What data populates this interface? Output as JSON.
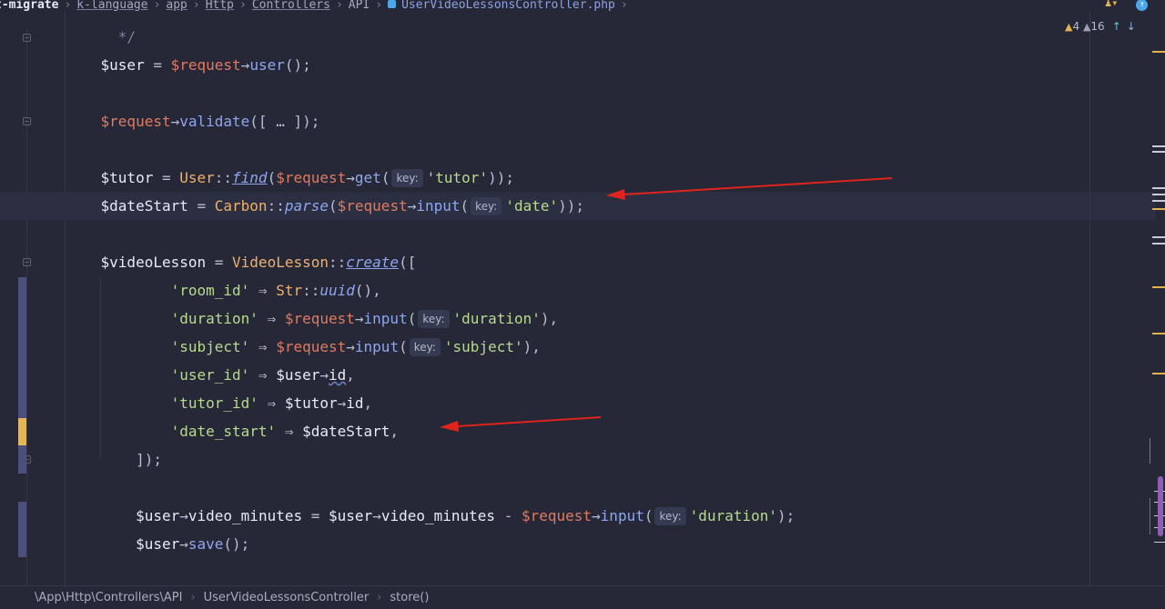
{
  "breadcrumb": {
    "items": [
      "t-migrate",
      "k-language",
      "app",
      "Http",
      "Controllers",
      "API",
      "UserVideoLessonsController.php"
    ]
  },
  "inspections": {
    "warnings": "4",
    "weak_warnings": "16",
    "icons": [
      "warning-icon",
      "weak-warning-icon",
      "prev-highlight-icon",
      "next-highlight-icon"
    ]
  },
  "top_right": {
    "icons": [
      "users-icon",
      "update-icon"
    ]
  },
  "code": {
    "comment_end": "*/",
    "l_user": {
      "var": "$user",
      "eq": " = ",
      "req": "$request",
      "arrow": "→",
      "fn": "user",
      "tail": "();"
    },
    "l_validate": {
      "req": "$request",
      "arrow": "→",
      "fn": "validate",
      "tail": "([ … ]);"
    },
    "l_tutor": {
      "var": "$tutor",
      "eq": " = ",
      "cls": "User",
      "dc": "::",
      "sfn": "find",
      "open": "(",
      "req": "$request",
      "arrow": "→",
      "fn": "get",
      "paren": "(",
      "hint": "key:",
      "str": "'tutor'",
      "tail": "));"
    },
    "l_date": {
      "var": "$dateStart",
      "eq": " = ",
      "cls": "Carbon",
      "dc": "::",
      "sfn": "parse",
      "open": "(",
      "req": "$request",
      "arrow": "→",
      "fn": "input",
      "paren": "(",
      "hint": "key:",
      "str": "'date'",
      "tail": "));"
    },
    "l_create": {
      "var": "$videoLesson",
      "eq": " = ",
      "cls": "VideoLesson",
      "dc": "::",
      "sfn": "create",
      "tail": "(["
    },
    "l_room": {
      "str": "'room_id'",
      "fat": " ⇒ ",
      "cls": "Str",
      "dc": "::",
      "sfn": "uuid",
      "tail": "(),"
    },
    "l_duration": {
      "str": "'duration'",
      "fat": " ⇒ ",
      "req": "$request",
      "arrow": "→",
      "fn": "input",
      "paren": "(",
      "hint": "key:",
      "str2": "'duration'",
      "tail": "),"
    },
    "l_subject": {
      "str": "'subject'",
      "fat": " ⇒ ",
      "req": "$request",
      "arrow": "→",
      "fn": "input",
      "paren": "(",
      "hint": "key:",
      "str2": "'subject'",
      "tail": "),"
    },
    "l_userid": {
      "str": "'user_id'",
      "fat": " ⇒ ",
      "var": "$user",
      "arrow": "→",
      "prop": "id",
      "tail": ","
    },
    "l_tutorid": {
      "str": "'tutor_id'",
      "fat": " ⇒ ",
      "var": "$tutor",
      "arrow": "→",
      "prop": "id",
      "tail": ","
    },
    "l_datestart": {
      "str": "'date_start'",
      "fat": " ⇒ ",
      "var": "$dateStart",
      "tail": ","
    },
    "l_close": "]);",
    "l_minutes": {
      "var": "$user",
      "arrow": "→",
      "prop": "video_minutes",
      "eq": " = ",
      "var2": "$user",
      "arrow2": "→",
      "prop2": "video_minutes",
      "minus": " - ",
      "req": "$request",
      "arrow3": "→",
      "fn": "input",
      "paren": "(",
      "hint": "key:",
      "str": "'duration'",
      "tail": ");"
    },
    "l_save": {
      "var": "$user",
      "arrow": "→",
      "fn": "save",
      "tail": "();"
    }
  },
  "bottom_breadcrumb": [
    "\\App\\Http\\Controllers\\API",
    "UserVideoLessonsController",
    "store()"
  ],
  "colors": {
    "background": "#262838",
    "variable": "#e8eaf5",
    "request_variable": "#e07a5f",
    "class": "#f0b06a",
    "function": "#8fa6ee",
    "string": "#b8d98e",
    "annotation_arrow": "#e0231c"
  }
}
